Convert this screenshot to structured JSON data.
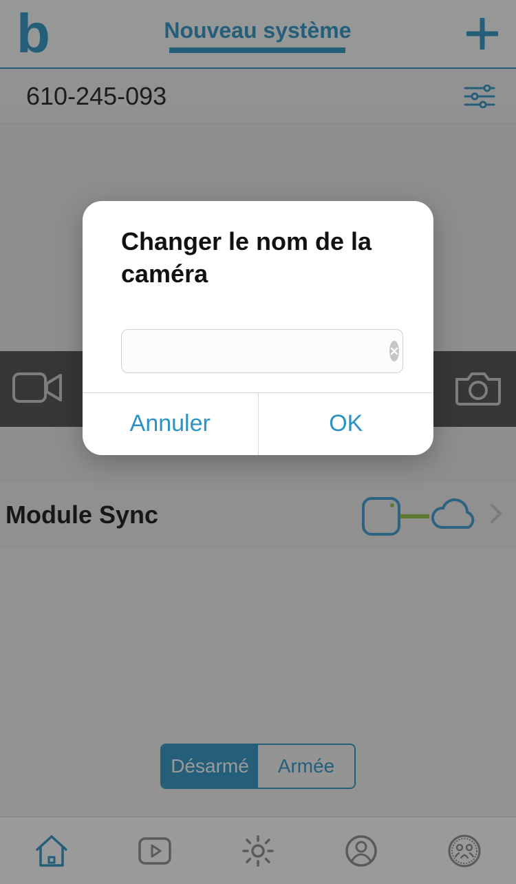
{
  "colors": {
    "accent": "#2a92c4"
  },
  "header": {
    "title": "Nouveau système"
  },
  "subheader": {
    "system_id": "610-245-093"
  },
  "module_row": {
    "label": "Module Sync"
  },
  "arm_segment": {
    "disarmed": "Désarmé",
    "armed": "Armée",
    "active": "disarmed"
  },
  "dialog": {
    "title": "Changer le nom de la caméra",
    "input_value": "",
    "cancel": "Annuler",
    "ok": "OK"
  },
  "tabbar": {
    "items": [
      "home",
      "clips",
      "settings",
      "account",
      "neighbors"
    ],
    "active": "home"
  }
}
